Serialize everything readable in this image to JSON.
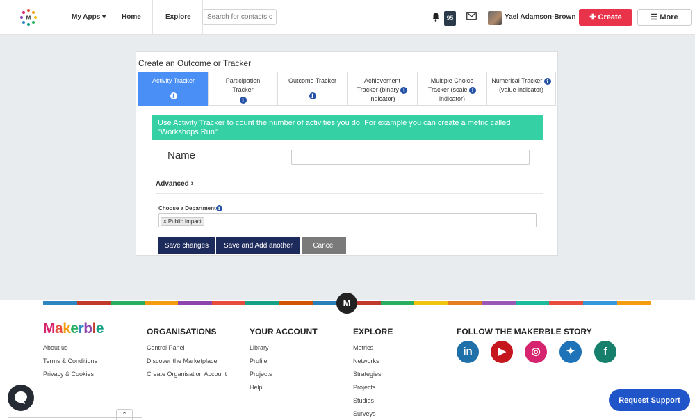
{
  "nav": {
    "my_apps": "My Apps",
    "home": "Home",
    "explore": "Explore",
    "search_placeholder": "Search for contacts or",
    "notification_count": "95",
    "user_name": "Yael Adamson-Brown",
    "create_label": "Create",
    "more_label": "More"
  },
  "modal": {
    "title": "Create an Outcome or Tracker",
    "tabs": [
      {
        "line1": "Activity Tracker",
        "line2": ""
      },
      {
        "line1": "Participation",
        "line2": "Tracker"
      },
      {
        "line1": "Outcome Tracker",
        "line2": ""
      },
      {
        "line1": "Achievement",
        "line2": "Tracker (binary",
        "line3": "indicator)"
      },
      {
        "line1": "Multiple Choice",
        "line2": "Tracker (scale",
        "line3": "indicator)"
      },
      {
        "line1": "Numerical Tracker",
        "line2": "(value indicator)"
      }
    ],
    "alert": "Use Activity Tracker to count the number of activities you do. For example you can create a metric called \"Workshops Run\"",
    "name_label": "Name",
    "advanced_label": "Advanced",
    "department_label": "Choose a Department",
    "department_chip": "Public Impact",
    "save_label": "Save changes",
    "save_add_label": "Save and Add another",
    "cancel_label": "Cancel"
  },
  "footer": {
    "brand": "Makerble",
    "about": [
      "About us",
      "Terms & Conditions",
      "Privacy & Cookies"
    ],
    "organisations": {
      "title": "ORGANISATIONS",
      "links": [
        "Control Panel",
        "Discover the Marketplace",
        "Create Organisation Account"
      ]
    },
    "account": {
      "title": "YOUR ACCOUNT",
      "links": [
        "Library",
        "Profile",
        "Projects",
        "Help"
      ]
    },
    "explore": {
      "title": "EXPLORE",
      "links": [
        "Metrics",
        "Networks",
        "Strategies",
        "Projects",
        "Studies",
        "Surveys"
      ]
    },
    "follow": {
      "title": "FOLLOW THE MAKERBLE STORY"
    },
    "social": [
      {
        "icon": "linkedin-icon",
        "glyph": "in",
        "color": "#1f6fa8"
      },
      {
        "icon": "youtube-icon",
        "glyph": "▶",
        "color": "#c4161c"
      },
      {
        "icon": "instagram-icon",
        "glyph": "◎",
        "color": "#d6246e"
      },
      {
        "icon": "twitter-icon",
        "glyph": "✦",
        "color": "#1d72b8"
      },
      {
        "icon": "facebook-icon",
        "glyph": "f",
        "color": "#16806d"
      }
    ],
    "m_badge": "M",
    "request_support": "Request Support"
  },
  "colors": {
    "accent_create": "#e8334b",
    "tab_active": "#4a8ff5",
    "alert_green": "#35d1a5",
    "primary_button": "#1d2a5c",
    "stripe": [
      "#2e86c1",
      "#c0392b",
      "#27ae60",
      "#f39c12",
      "#8e44ad",
      "#e74c3c",
      "#16a085",
      "#d35400",
      "#2980b9",
      "#c0392b",
      "#27ae60",
      "#f1c40f",
      "#e67e22",
      "#9b59b6",
      "#1abc9c",
      "#e74c3c",
      "#3498db",
      "#f39c12"
    ]
  }
}
